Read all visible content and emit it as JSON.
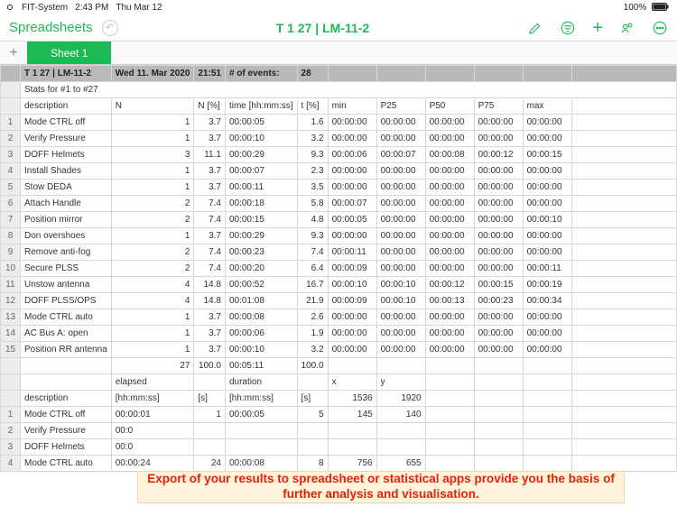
{
  "statusbar": {
    "app": "FIT-System",
    "time": "2:43 PM",
    "date": "Thu Mar 12",
    "battery": "100%"
  },
  "toolbar": {
    "back": "Spreadsheets",
    "title": "T 1   27 | LM-11-2"
  },
  "tabs": {
    "sheet1": "Sheet 1"
  },
  "hdr1": [
    "T 1   27 | LM-11-2",
    "Wed 11. Mar 2020",
    "21:51",
    "# of events:",
    "28"
  ],
  "stats_for": "Stats for #1 to #27",
  "cols": [
    "description",
    "N",
    "N [%]",
    "time [hh:mm:ss]",
    "t [%]",
    "min",
    "P25",
    "P50",
    "P75",
    "max"
  ],
  "rows": [
    {
      "n": "1",
      "d": "Mode CTRL off",
      "N": "1",
      "Np": "3.7",
      "t": "00:00:05",
      "tp": "1.6",
      "min": "00:00:00",
      "p25": "00:00:00",
      "p50": "00:00:00",
      "p75": "00:00:00",
      "max": "00:00:00"
    },
    {
      "n": "2",
      "d": "Verify Pressure",
      "N": "1",
      "Np": "3.7",
      "t": "00:00:10",
      "tp": "3.2",
      "min": "00:00:00",
      "p25": "00:00:00",
      "p50": "00:00:00",
      "p75": "00:00:00",
      "max": "00:00:00"
    },
    {
      "n": "3",
      "d": "DOFF Helmets",
      "N": "3",
      "Np": "11.1",
      "t": "00:00:29",
      "tp": "9.3",
      "min": "00:00:06",
      "p25": "00:00:07",
      "p50": "00:00:08",
      "p75": "00:00:12",
      "max": "00:00:15"
    },
    {
      "n": "4",
      "d": "Install Shades",
      "N": "1",
      "Np": "3.7",
      "t": "00:00:07",
      "tp": "2.3",
      "min": "00:00:00",
      "p25": "00:00:00",
      "p50": "00:00:00",
      "p75": "00:00:00",
      "max": "00:00:00"
    },
    {
      "n": "5",
      "d": "Stow DEDA",
      "N": "1",
      "Np": "3.7",
      "t": "00:00:11",
      "tp": "3.5",
      "min": "00:00:00",
      "p25": "00:00:00",
      "p50": "00:00:00",
      "p75": "00:00:00",
      "max": "00:00:00"
    },
    {
      "n": "6",
      "d": "Attach Handle",
      "N": "2",
      "Np": "7.4",
      "t": "00:00:18",
      "tp": "5.8",
      "min": "00:00:07",
      "p25": "00:00:00",
      "p50": "00:00:00",
      "p75": "00:00:00",
      "max": "00:00:00"
    },
    {
      "n": "7",
      "d": "Position mirror",
      "N": "2",
      "Np": "7.4",
      "t": "00:00:15",
      "tp": "4.8",
      "min": "00:00:05",
      "p25": "00:00:00",
      "p50": "00:00:00",
      "p75": "00:00:00",
      "max": "00:00:10"
    },
    {
      "n": "8",
      "d": "Don overshoes",
      "N": "1",
      "Np": "3.7",
      "t": "00:00:29",
      "tp": "9.3",
      "min": "00:00:00",
      "p25": "00:00:00",
      "p50": "00:00:00",
      "p75": "00:00:00",
      "max": "00:00:00"
    },
    {
      "n": "9",
      "d": "Remove anti-fog",
      "N": "2",
      "Np": "7.4",
      "t": "00:00:23",
      "tp": "7.4",
      "min": "00:00:11",
      "p25": "00:00:00",
      "p50": "00:00:00",
      "p75": "00:00:00",
      "max": "00:00:00"
    },
    {
      "n": "10",
      "d": "Secure PLSS",
      "N": "2",
      "Np": "7.4",
      "t": "00:00:20",
      "tp": "6.4",
      "min": "00:00:09",
      "p25": "00:00:00",
      "p50": "00:00:00",
      "p75": "00:00:00",
      "max": "00:00:11"
    },
    {
      "n": "11",
      "d": "Unstow antenna",
      "N": "4",
      "Np": "14.8",
      "t": "00:00:52",
      "tp": "16.7",
      "min": "00:00:10",
      "p25": "00:00:10",
      "p50": "00:00:12",
      "p75": "00:00:15",
      "max": "00:00:19"
    },
    {
      "n": "12",
      "d": "DOFF PLSS/OPS",
      "N": "4",
      "Np": "14.8",
      "t": "00:01:08",
      "tp": "21.9",
      "min": "00:00:09",
      "p25": "00:00:10",
      "p50": "00:00:13",
      "p75": "00:00:23",
      "max": "00:00:34"
    },
    {
      "n": "13",
      "d": "Mode CTRL auto",
      "N": "1",
      "Np": "3.7",
      "t": "00:00:08",
      "tp": "2.6",
      "min": "00:00:00",
      "p25": "00:00:00",
      "p50": "00:00:00",
      "p75": "00:00:00",
      "max": "00:00:00"
    },
    {
      "n": "14",
      "d": "AC Bus A: open",
      "N": "1",
      "Np": "3.7",
      "t": "00:00:06",
      "tp": "1.9",
      "min": "00:00:00",
      "p25": "00:00:00",
      "p50": "00:00:00",
      "p75": "00:00:00",
      "max": "00:00:00"
    },
    {
      "n": "15",
      "d": "Position RR antenna",
      "N": "1",
      "Np": "3.7",
      "t": "00:00:10",
      "tp": "3.2",
      "min": "00:00:00",
      "p25": "00:00:00",
      "p50": "00:00:00",
      "p75": "00:00:00",
      "max": "00:00:00"
    }
  ],
  "total": {
    "N": "27",
    "Np": "100.0",
    "t": "00:05:11",
    "tp": "100.0"
  },
  "hdr2": {
    "elapsed": "elapsed",
    "duration": "duration",
    "x": "x",
    "y": "y"
  },
  "cols2": [
    "description",
    "[hh:mm:ss]",
    "[s]",
    "[hh:mm:ss]",
    "[s]",
    "1536",
    "1920"
  ],
  "rows2": [
    {
      "n": "1",
      "d": "Mode CTRL off",
      "el": "00:00:01",
      "s": "1",
      "du": "00:00:05",
      "ds": "5",
      "x": "145",
      "y": "140"
    },
    {
      "n": "2",
      "d": "Verify Pressure",
      "el": "00:0",
      "s": "",
      "du": "",
      "ds": "",
      "x": "",
      "y": ""
    },
    {
      "n": "3",
      "d": "DOFF Helmets",
      "el": "00:0",
      "s": "",
      "du": "",
      "ds": "",
      "x": "",
      "y": ""
    },
    {
      "n": "4",
      "d": "Mode CTRL auto",
      "el": "00:00:24",
      "s": "24",
      "du": "00:00:08",
      "ds": "8",
      "x": "756",
      "y": "655"
    }
  ],
  "overlay": "Export of your results to spreadsheet or statistical apps provide you the basis of further analysis and visualisation."
}
